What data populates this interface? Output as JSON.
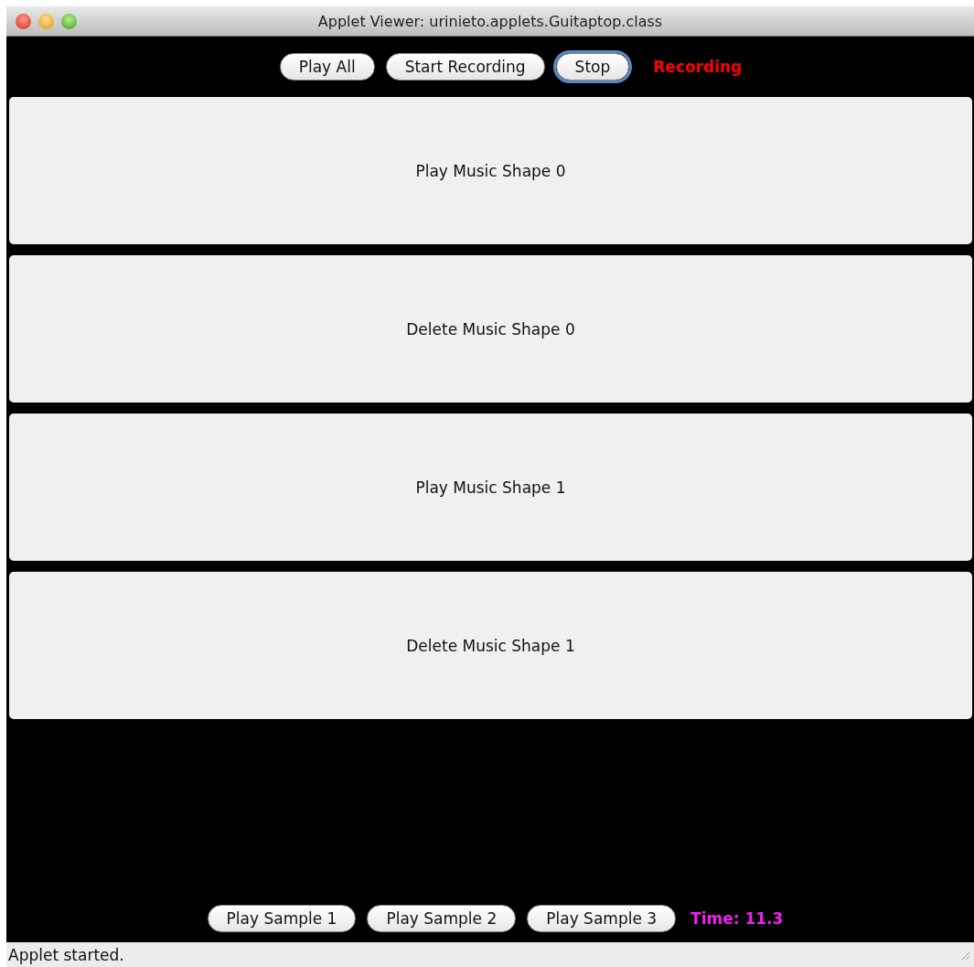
{
  "window": {
    "title": "Applet Viewer: urinieto.applets.Guitaptop.class"
  },
  "top_bar": {
    "buttons": [
      {
        "label": "Play All",
        "focused": false
      },
      {
        "label": "Start Recording",
        "focused": false
      },
      {
        "label": "Stop",
        "focused": true
      }
    ],
    "status": "Recording"
  },
  "shape_buttons": [
    "Play Music Shape 0",
    "Delete Music Shape 0",
    "Play Music Shape 1",
    "Delete Music Shape 1"
  ],
  "bottom_bar": {
    "buttons": [
      "Play Sample 1",
      "Play Sample 2",
      "Play Sample 3"
    ],
    "time": "Time: 11.3"
  },
  "status_bar": "Applet started."
}
